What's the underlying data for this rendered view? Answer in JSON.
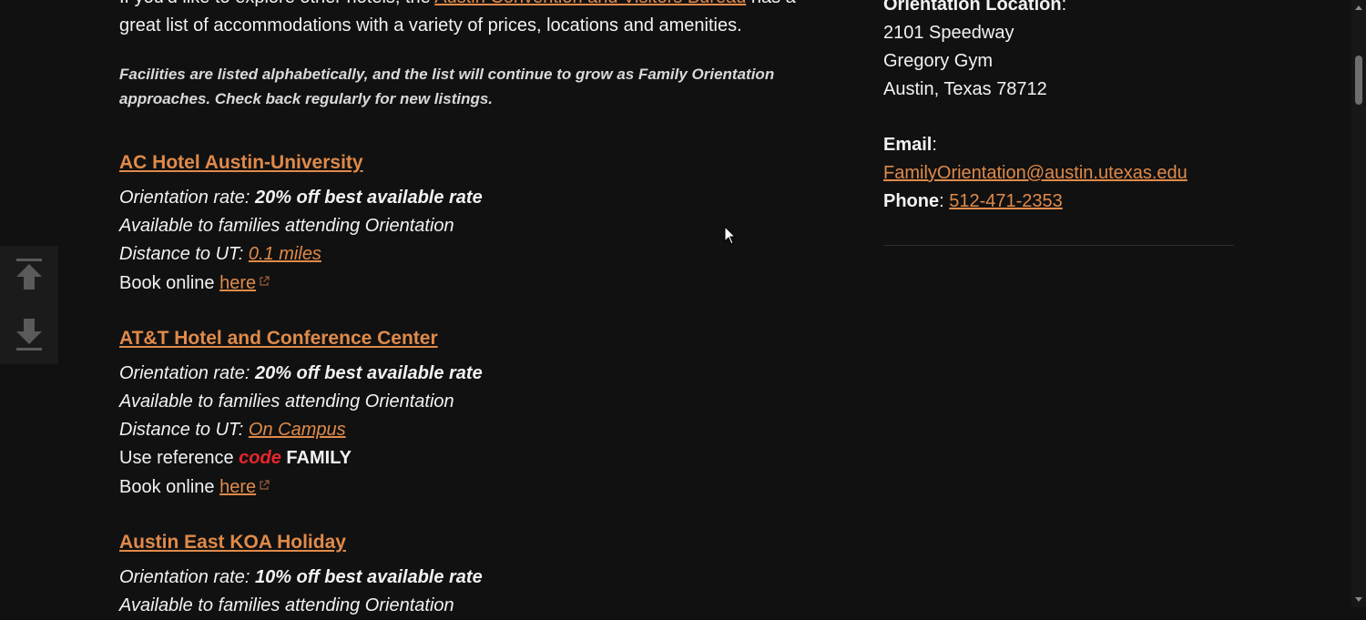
{
  "intro": {
    "before": "If you'd like to explore other hotels, the ",
    "link": "Austin Convention and Visitors Bureau",
    "after": " has a great list of accommodations with a variety of prices, locations and amenities."
  },
  "note": "Facilities are listed alphabetically, and the list will continue to grow as Family Orientation approaches. Check back regularly for new listings.",
  "hotels": [
    {
      "name": "AC Hotel Austin-University",
      "rate_label": "Orientation rate: ",
      "rate_value": "20% off best available rate",
      "available": "Available to families attending Orientation",
      "distance_label": "Distance to UT: ",
      "distance_value": "0.1 miles",
      "book_label": "Book online ",
      "book_link": "here"
    },
    {
      "name": "AT&T Hotel and Conference Center",
      "rate_label": "Orientation rate: ",
      "rate_value": "20% off best available rate",
      "available": "Available to families attending Orientation",
      "distance_label": "Distance to UT: ",
      "distance_value": "On Campus",
      "code_label": "Use reference ",
      "code_word": "code",
      "code_value": "FAMILY",
      "book_label": "Book online ",
      "book_link": "here"
    },
    {
      "name": "Austin East KOA Holiday",
      "rate_label": "Orientation rate: ",
      "rate_value": "10% off best available rate",
      "available": "Available to families attending Orientation"
    }
  ],
  "sidebar": {
    "location_label": "Orientation Location",
    "location_colon": ":",
    "address_line1": "2101 Speedway",
    "address_line2": "Gregory Gym",
    "address_line3": "Austin, Texas 78712",
    "email_label": "Email",
    "email_colon": ":",
    "email_value": "FamilyOrientation@austin.utexas.edu",
    "phone_label": "Phone",
    "phone_colon": ": ",
    "phone_value": "512-471-2353"
  },
  "icons": {
    "external_link": "external-link-icon",
    "scroll_top": "arrow-up-to-top-icon",
    "scroll_bottom": "arrow-down-to-bottom-icon"
  },
  "colors": {
    "background": "#111111",
    "link": "#e08a4a",
    "code_accent": "#e8262b"
  }
}
